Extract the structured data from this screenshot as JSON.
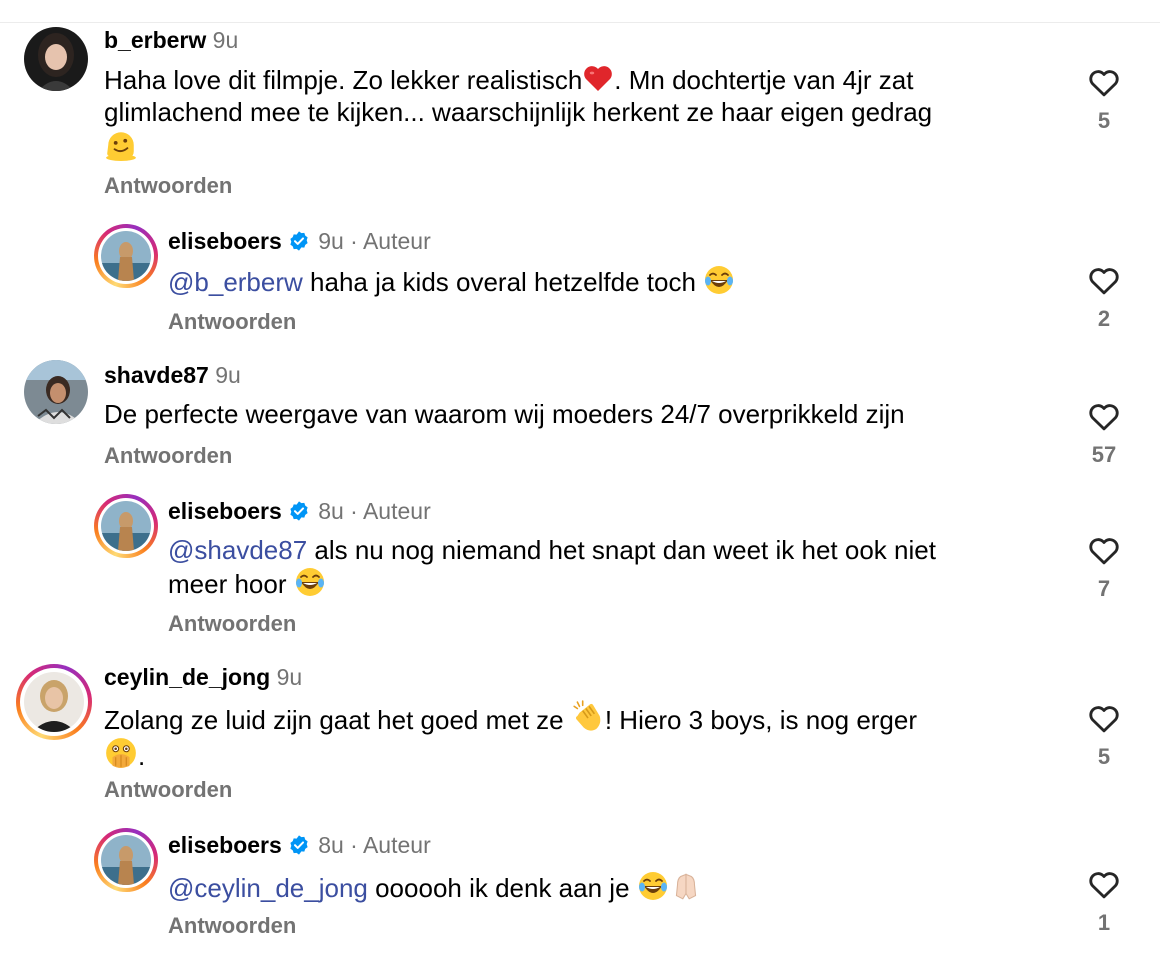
{
  "comments": [
    {
      "username": "b_erberw",
      "time": "9u",
      "text_parts": [
        "Haha love dit filmpje. Zo lekker realistisch",
        ". Mn dochtertje van 4jr zat",
        "glimlachend mee te kijken... waarschijnlijk herkent ze haar eigen gedrag"
      ],
      "reply_label": "Antwoorden",
      "like_count": "5",
      "icons": [
        "heart-emoji",
        "melting-face-emoji"
      ]
    },
    {
      "username": "eliseboers",
      "verified": true,
      "time": "9u",
      "author_label": "Auteur",
      "mention": "@b_erberw",
      "text": " haha ja kids overal hetzelfde toch ",
      "reply_label": "Antwoorden",
      "like_count": "2",
      "icons": [
        "tears-of-joy-emoji"
      ]
    },
    {
      "username": "shavde87",
      "time": "9u",
      "text": "De perfecte weergave van waarom wij moeders 24/7 overprikkeld zijn",
      "reply_label": "Antwoorden",
      "like_count": "57"
    },
    {
      "username": "eliseboers",
      "verified": true,
      "time": "8u",
      "author_label": "Auteur",
      "mention": "@shavde87",
      "text": " als nu nog niemand het snapt dan weet ik het ook niet",
      "text_line2": "meer hoor ",
      "reply_label": "Antwoorden",
      "like_count": "7",
      "icons": [
        "tears-of-joy-emoji"
      ]
    },
    {
      "username": "ceylin_de_jong",
      "time": "9u",
      "text_parts": [
        "Zolang ze luid zijn gaat het goed met ze ",
        "! Hiero 3 boys, is nog erger",
        "."
      ],
      "reply_label": "Antwoorden",
      "like_count": "5",
      "icons": [
        "clapping-hands-emoji",
        "face-with-open-eyes-and-hand-over-mouth-emoji"
      ]
    },
    {
      "username": "eliseboers",
      "verified": true,
      "time": "8u",
      "author_label": "Auteur",
      "mention": "@ceylin_de_jong",
      "text": " oooooh ik denk aan je ",
      "reply_label": "Antwoorden",
      "like_count": "1",
      "icons": [
        "tears-of-joy-emoji",
        "folded-hands-emoji"
      ]
    }
  ],
  "meta_separator": "·",
  "colors": {
    "mention": "#3b4ea0",
    "secondary_text": "#737373",
    "verified_badge": "#0095f6"
  }
}
